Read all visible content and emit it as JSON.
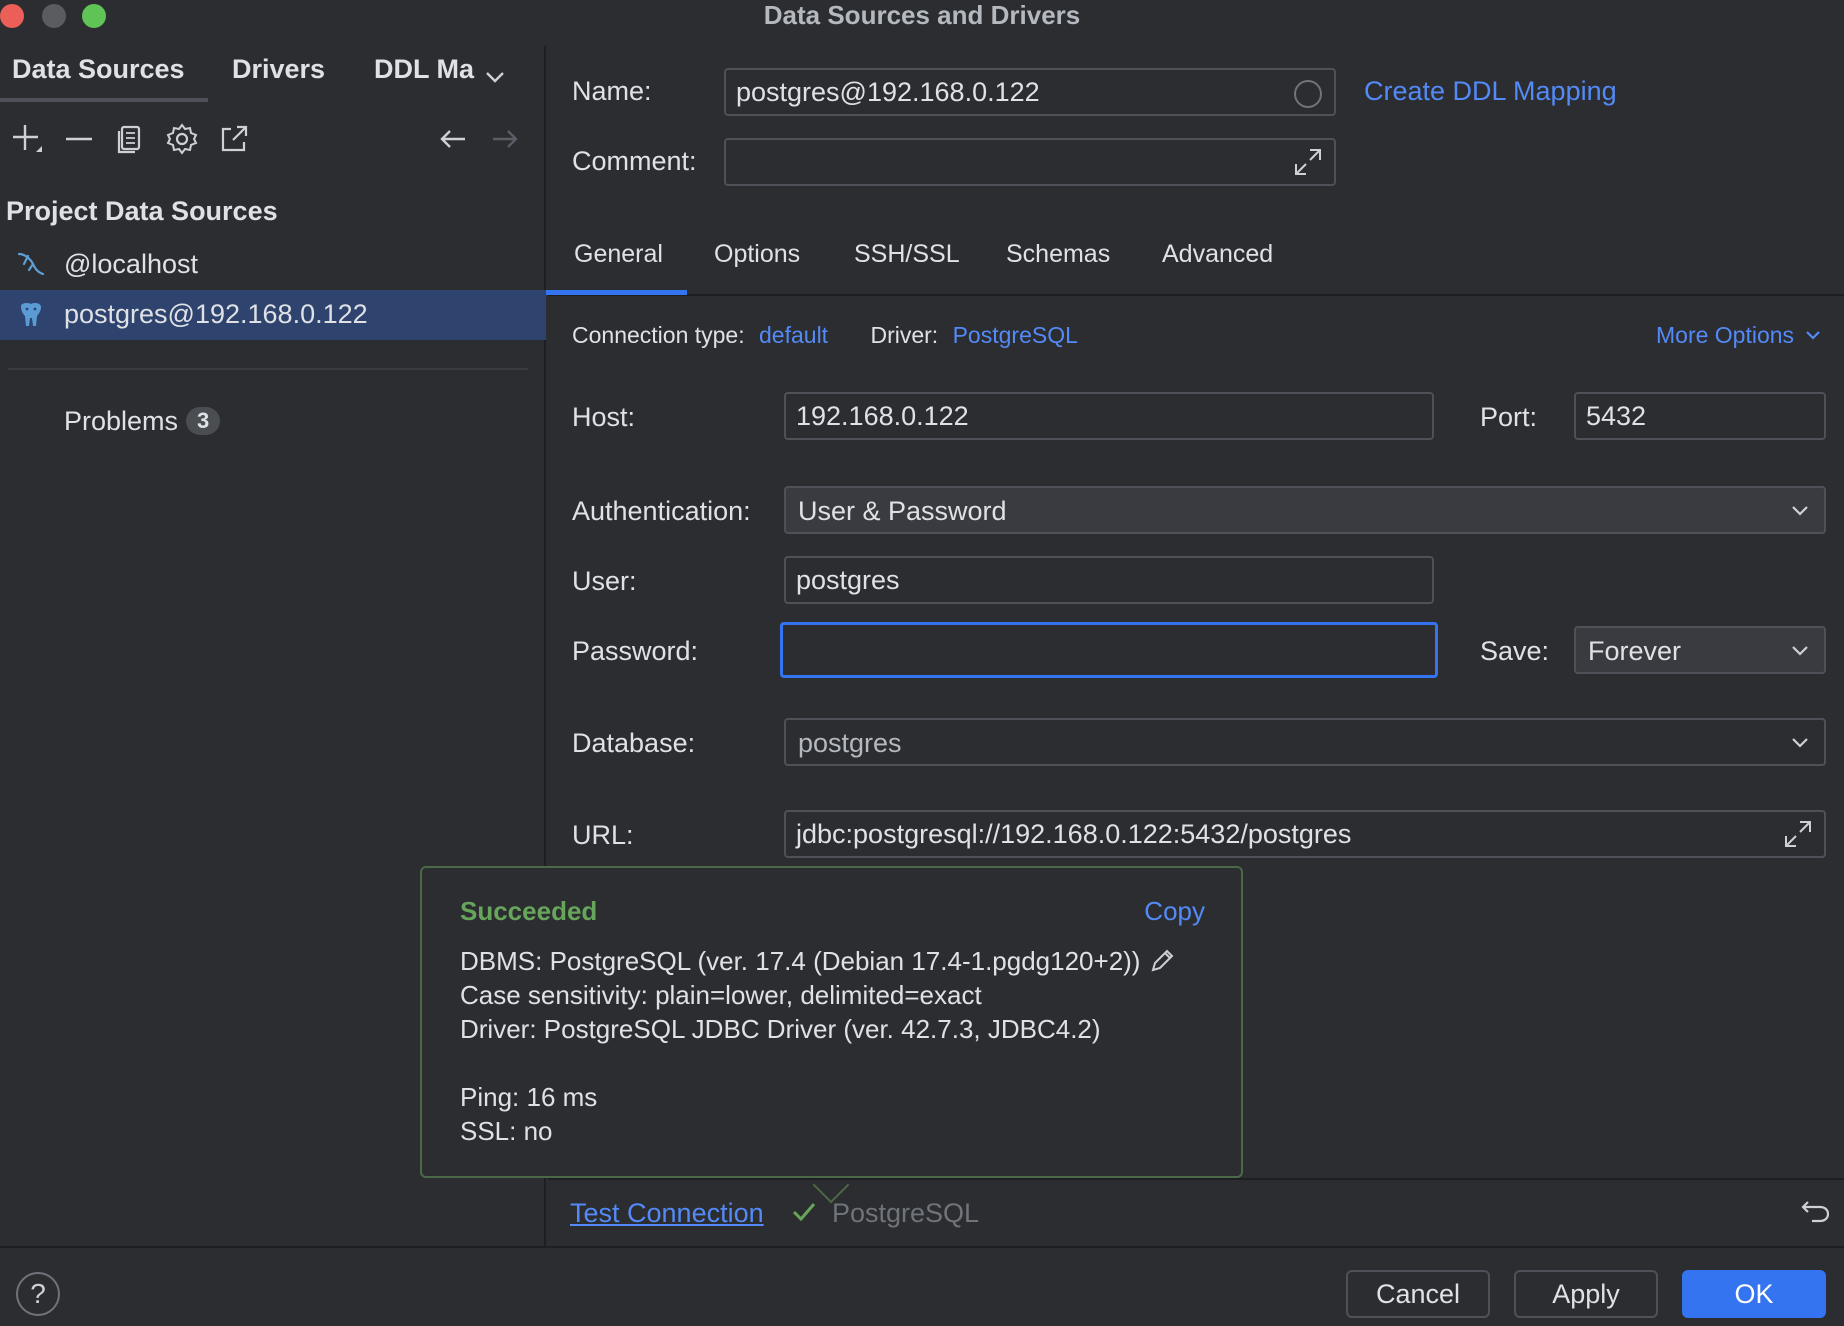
{
  "window": {
    "title": "Data Sources and Drivers",
    "traffic_colors": {
      "close": "#ec5f59",
      "minimize": "#5a5c60",
      "maximize": "#5fc455"
    }
  },
  "sidebar": {
    "tabs": [
      "Data Sources",
      "Drivers",
      "DDL Ma"
    ],
    "toolbar_icons": [
      "plus-icon",
      "minus-icon",
      "duplicate-icon",
      "gear-icon",
      "open-external-icon",
      "arrow-left-icon",
      "arrow-right-icon"
    ],
    "section_title": "Project Data Sources",
    "items": [
      {
        "label": "@localhost",
        "icon": "mysql-dolphin-icon",
        "selected": false
      },
      {
        "label": "postgres@192.168.0.122",
        "icon": "postgresql-elephant-icon",
        "selected": true
      }
    ],
    "problems_label": "Problems",
    "problems_count": "3"
  },
  "header": {
    "name_label": "Name:",
    "name_value": "postgres@192.168.0.122",
    "create_ddl_link": "Create DDL Mapping",
    "comment_label": "Comment:",
    "comment_value": ""
  },
  "tabs": [
    {
      "label": "General",
      "active": true
    },
    {
      "label": "Options",
      "active": false
    },
    {
      "label": "SSH/SSL",
      "active": false
    },
    {
      "label": "Schemas",
      "active": false
    },
    {
      "label": "Advanced",
      "active": false
    }
  ],
  "general": {
    "connection_type_label": "Connection type:",
    "connection_type_value": "default",
    "driver_label": "Driver:",
    "driver_value": "PostgreSQL",
    "more_options": "More Options",
    "host_label": "Host:",
    "host_value": "192.168.0.122",
    "port_label": "Port:",
    "port_value": "5432",
    "auth_label": "Authentication:",
    "auth_value": "User & Password",
    "user_label": "User:",
    "user_value": "postgres",
    "password_label": "Password:",
    "password_value": "",
    "save_label": "Save:",
    "save_value": "Forever",
    "database_label": "Database:",
    "database_value": "postgres",
    "url_label": "URL:",
    "url_value": "jdbc:postgresql://192.168.0.122:5432/postgres"
  },
  "popup": {
    "status": "Succeeded",
    "copy": "Copy",
    "lines": [
      "DBMS: PostgreSQL (ver. 17.4 (Debian 17.4-1.pgdg120+2))",
      "Case sensitivity: plain=lower, delimited=exact",
      "Driver: PostgreSQL JDBC Driver (ver. 42.7.3, JDBC4.2)",
      "Ping: 16 ms",
      "SSL: no"
    ]
  },
  "footer": {
    "test_connection": "Test Connection",
    "test_driver": "PostgreSQL",
    "cancel": "Cancel",
    "apply": "Apply",
    "ok": "OK",
    "help": "?"
  },
  "colors": {
    "accent": "#3574f0",
    "link": "#548af7",
    "success": "#67a55b",
    "selection": "#2e436e"
  }
}
